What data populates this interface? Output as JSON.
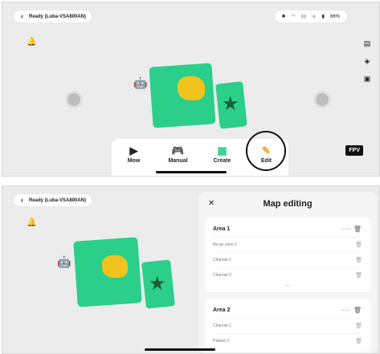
{
  "top": {
    "status": "Ready  (Luba-VSA800AN)",
    "sys": {
      "battery": "66%"
    },
    "dock": [
      {
        "icon": "▶",
        "label": "Mow"
      },
      {
        "icon": "🎮",
        "label": "Manual"
      },
      {
        "icon": "▦",
        "label": "Create"
      },
      {
        "icon": "✎",
        "label": "Edit"
      }
    ],
    "fpv": "FPV"
  },
  "bottom": {
    "status": "Ready  (Luba-VSA800AN)",
    "editor": {
      "title": "Map editing",
      "areas": [
        {
          "name": "Area 1",
          "rows": [
            "No-go zone 1",
            "Channel 2",
            "Channel 3"
          ]
        },
        {
          "name": "Area 2",
          "rows": [
            "Channel 1",
            "Pattern 2"
          ]
        }
      ]
    }
  },
  "colors": {
    "lawn": "#2bcf8a",
    "obstacle": "#f2c31f",
    "accent": "#f2a51f"
  }
}
